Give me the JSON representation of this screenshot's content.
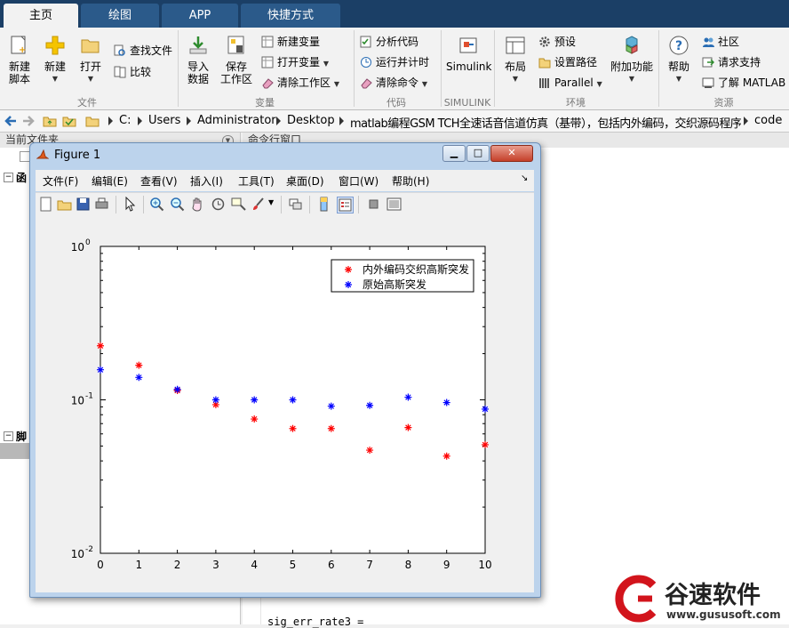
{
  "tabs": [
    {
      "label": "主页",
      "active": true
    },
    {
      "label": "绘图",
      "active": false
    },
    {
      "label": "APP",
      "active": false
    },
    {
      "label": "快捷方式",
      "active": false
    }
  ],
  "ribbon": {
    "file": {
      "new_script": "新建\n脚本",
      "new": "新建",
      "open": "打开",
      "find_files": "查找文件",
      "compare": "比较",
      "group": "文件"
    },
    "variable": {
      "import": "导入\n数据",
      "save_ws": "保存\n工作区",
      "new_var": "新建变量",
      "open_var": "打开变量",
      "clear_ws": "清除工作区",
      "group": "变量"
    },
    "code": {
      "analyze": "分析代码",
      "run_time": "运行并计时",
      "clear_cmd": "清除命令",
      "group": "代码"
    },
    "simulink": {
      "label": "Simulink",
      "group": "SIMULINK"
    },
    "environment": {
      "layout": "布局",
      "prefs": "预设",
      "set_path": "设置路径",
      "parallel": "Parallel",
      "addons": "附加功能",
      "group": "环境"
    },
    "resources": {
      "help": "帮助",
      "community": "社区",
      "support": "请求支持",
      "learn": "了解 MATLAB",
      "group": "资源"
    }
  },
  "address": {
    "crumbs": [
      "C:",
      "Users",
      "Administrator",
      "Desktop",
      "matlab编程GSM TCH全速话音信道仿真（基带），包括内外编码，交织源码程序",
      "code"
    ]
  },
  "panes": {
    "current_folder": "当前文件夹",
    "command_window": "命令行窗口",
    "func_node": "函",
    "script_node": "脚",
    "command_text": "sig_err_rate3 ="
  },
  "figure": {
    "title": "Figure 1",
    "menu": [
      "文件(F)",
      "编辑(E)",
      "查看(V)",
      "插入(I)",
      "工具(T)",
      "桌面(D)",
      "窗口(W)",
      "帮助(H)"
    ],
    "menu_arrow": "↘"
  },
  "chart_data": {
    "type": "scatter",
    "title": "",
    "xlabel": "",
    "ylabel": "",
    "xlim": [
      0,
      10
    ],
    "ylim": [
      0.01,
      1
    ],
    "yscale": "log",
    "grid": false,
    "legend_position": "top-right",
    "x_ticks": [
      0,
      1,
      2,
      3,
      4,
      5,
      6,
      7,
      8,
      9,
      10
    ],
    "y_ticks": [
      {
        "value": 1,
        "label": "10",
        "exp": "0"
      },
      {
        "value": 0.1,
        "label": "10",
        "exp": "-1"
      },
      {
        "value": 0.01,
        "label": "10",
        "exp": "-2"
      }
    ],
    "x": [
      0,
      1,
      2,
      3,
      4,
      5,
      6,
      7,
      8,
      9,
      10
    ],
    "series": [
      {
        "name": "内外编码交织高斯突发",
        "color": "#ff0000",
        "marker": "*",
        "values": [
          0.225,
          0.168,
          0.115,
          0.093,
          0.075,
          0.065,
          0.065,
          0.047,
          0.066,
          0.043,
          0.051
        ]
      },
      {
        "name": "原始高斯突发",
        "color": "#0000ff",
        "marker": "*",
        "values": [
          0.157,
          0.14,
          0.117,
          0.1,
          0.1,
          0.1,
          0.091,
          0.092,
          0.104,
          0.096,
          0.087
        ]
      }
    ]
  },
  "watermark": {
    "brand": "谷速软件",
    "url": "www.gususoft.com"
  },
  "colors": {
    "accent": "#1b3f66",
    "figure_frame": "#bcd3ec"
  }
}
